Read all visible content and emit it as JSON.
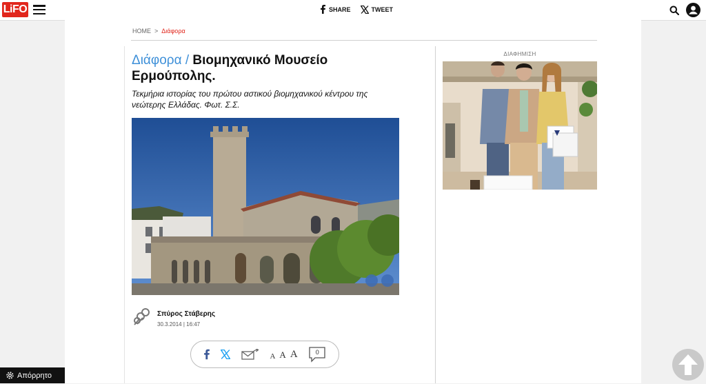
{
  "header": {
    "logo_text": "LiFO",
    "share_label": "SHARE",
    "tweet_label": "TWEET",
    "icons": [
      "menu-icon",
      "facebook-icon",
      "x-icon",
      "search-icon",
      "user-icon"
    ]
  },
  "breadcrumb": {
    "home": "HOME",
    "separator": ">",
    "current": "Διάφορα"
  },
  "article": {
    "category": "Διάφορα /",
    "title": "Βιομηχανικό Μουσείο Ερμούπολης.",
    "subtitle": "Τεκμήρια ιστορίας του πρώτου αστικού βιομηχανικού κέντρου της νεώτερης Ελλάδας. Φωτ. Σ.Σ.",
    "author_name": "Σπύρος Στάβερης",
    "date": "30.3.2014 | 16:47"
  },
  "tools": {
    "font_small": "A",
    "font_medium": "A",
    "font_large": "A",
    "comments_count": "0"
  },
  "sidebar": {
    "ad_label": "ΔΙΑΦΗΜΙΣΗ"
  },
  "footer": {
    "privacy_label": "Απόρρητο"
  },
  "colors": {
    "brand_red": "#e1261c",
    "category_blue": "#3d8fd8",
    "facebook_blue": "#3b5998",
    "x_blue": "#1da1f2"
  }
}
